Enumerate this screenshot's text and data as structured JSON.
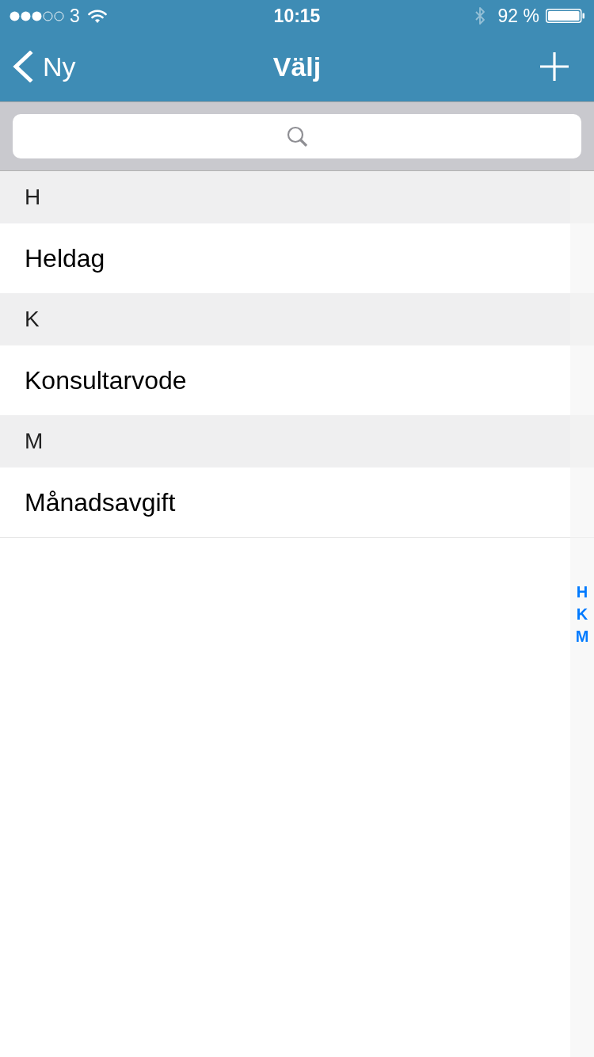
{
  "status_bar": {
    "carrier": "3",
    "time": "10:15",
    "battery": "92 %"
  },
  "nav_bar": {
    "back_button": "Ny",
    "title": "Välj"
  },
  "sections": [
    {
      "letter": "H",
      "items": [
        "Heldag"
      ]
    },
    {
      "letter": "K",
      "items": [
        "Konsultarvode"
      ]
    },
    {
      "letter": "M",
      "items": [
        "Månadsavgift"
      ]
    }
  ],
  "section_index": [
    "H",
    "K",
    "M"
  ]
}
